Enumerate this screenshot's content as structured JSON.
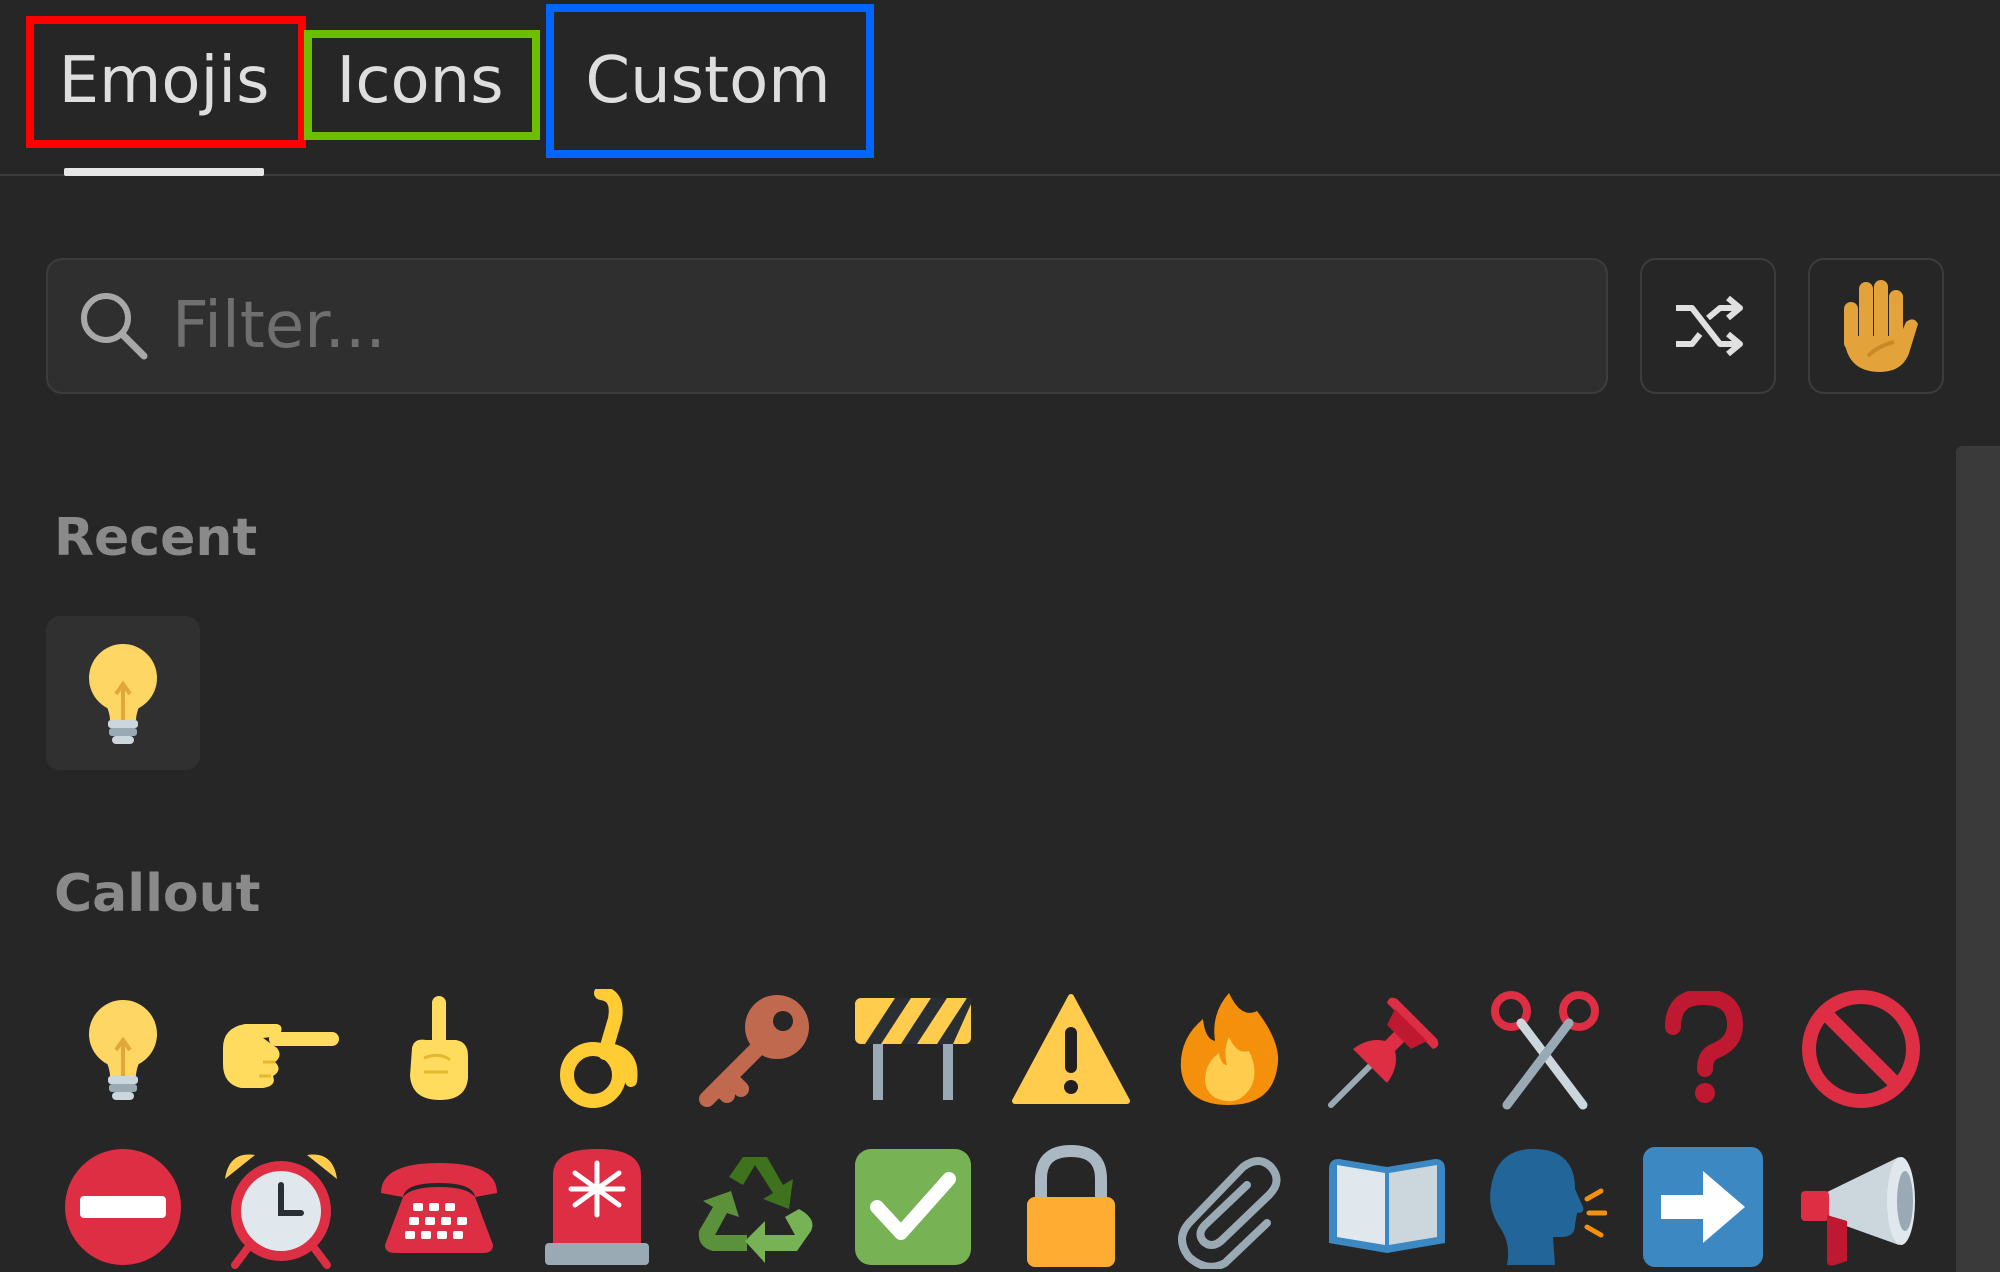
{
  "tabs": [
    {
      "label": "Emojis",
      "active": true,
      "outline_color": "#ff0000"
    },
    {
      "label": "Icons",
      "active": false,
      "outline_color": "#6cbf00"
    },
    {
      "label": "Custom",
      "active": false,
      "outline_color": "#0066ff"
    }
  ],
  "search": {
    "placeholder": "Filter...",
    "value": ""
  },
  "buttons": {
    "shuffle_icon": "shuffle-icon",
    "skin_tone_icon": "raised-hand-icon"
  },
  "sections": [
    {
      "title": "Recent",
      "emojis": [
        "light-bulb"
      ]
    },
    {
      "title": "Callout",
      "emojis": [
        "light-bulb",
        "pointing-right",
        "pointing-up",
        "ok-hand",
        "key",
        "construction",
        "warning",
        "fire",
        "pushpin",
        "scissors",
        "question-mark",
        "prohibited",
        "no-entry",
        "alarm-clock",
        "telephone",
        "police-light",
        "recycle",
        "check-box",
        "lock",
        "paperclip",
        "open-book",
        "speaking-head",
        "right-arrow",
        "megaphone"
      ]
    }
  ],
  "colors": {
    "background": "#262626",
    "input_bg": "#2f2f2f",
    "section_title": "#8a8a8a",
    "underline": "#e6e6e6"
  }
}
